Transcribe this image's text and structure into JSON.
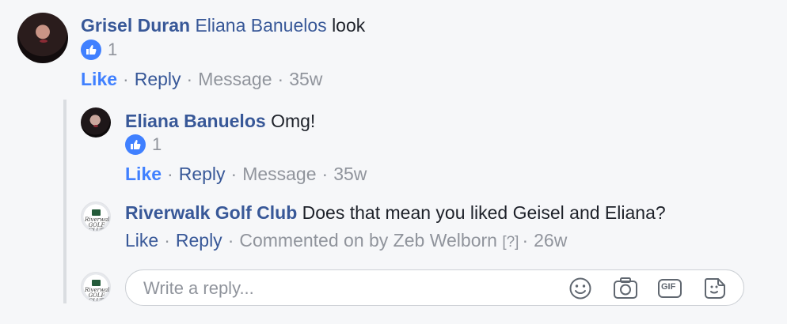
{
  "comments": [
    {
      "author": "Grisel Duran",
      "mention": "Eliana Banuelos",
      "text": "look",
      "reaction_count": "1",
      "actions": {
        "like": "Like",
        "reply": "Reply",
        "message": "Message",
        "time": "35w"
      }
    },
    {
      "author": "Eliana Banuelos",
      "text": "Omg!",
      "reaction_count": "1",
      "actions": {
        "like": "Like",
        "reply": "Reply",
        "message": "Message",
        "time": "35w"
      }
    },
    {
      "author": "Riverwalk Golf Club",
      "avatar_text": "Riverwalk GOLF CLUB",
      "text": "Does that mean you liked Geisel and Eliana?",
      "actions": {
        "like": "Like",
        "reply": "Reply",
        "commented_on": "Commented on by Zeb Welborn",
        "help": "[?]",
        "time": "26w"
      }
    }
  ],
  "reply_composer": {
    "placeholder": "Write a reply...",
    "avatar_text": "Riverwalk GOLF CLUB",
    "tools": [
      "emoji-icon",
      "camera-icon",
      "gif-icon",
      "sticker-icon"
    ],
    "gif_label": "GIF"
  },
  "colors": {
    "link": "#385898",
    "like_active": "#4080ff",
    "muted": "#90949c",
    "background": "#f6f7f9"
  }
}
